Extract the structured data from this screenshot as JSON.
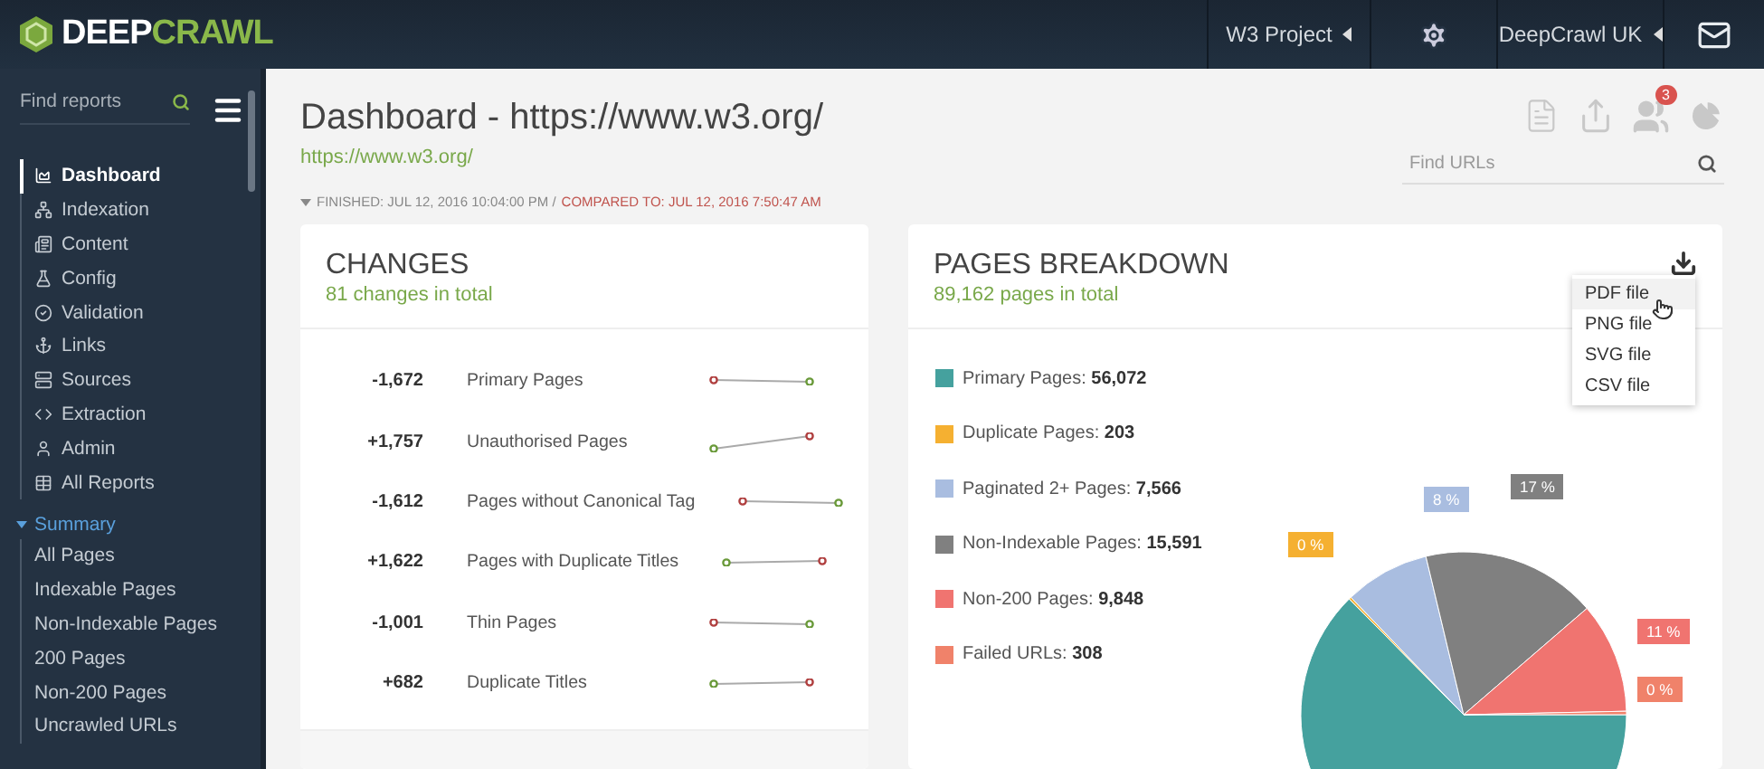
{
  "header": {
    "logo": {
      "lead": "DEEP",
      "tail": "CRAWL"
    },
    "project": "W3 Project",
    "account": "DeepCrawl UK"
  },
  "sidebar": {
    "search": {
      "placeholder": "Find reports"
    },
    "items": [
      {
        "label": "Dashboard",
        "selected": true
      },
      {
        "label": "Indexation",
        "selected": false
      },
      {
        "label": "Content",
        "selected": false
      },
      {
        "label": "Config",
        "selected": false
      },
      {
        "label": "Validation",
        "selected": false
      },
      {
        "label": "Links",
        "selected": false
      },
      {
        "label": "Sources",
        "selected": false
      },
      {
        "label": "Extraction",
        "selected": false
      },
      {
        "label": "Admin",
        "selected": false
      },
      {
        "label": "All Reports",
        "selected": false
      }
    ],
    "section": {
      "label": "Summary",
      "expanded": true,
      "children": [
        "All Pages",
        "Indexable Pages",
        "Non-Indexable Pages",
        "200 Pages",
        "Non-200 Pages",
        "Uncrawled URLs"
      ]
    }
  },
  "page": {
    "title": "Dashboard - https://www.w3.org/",
    "url": "https://www.w3.org/",
    "finished": "FINISHED: JUL 12, 2016 10:04:00 PM /",
    "compared": "COMPARED TO: JUL 12, 2016 7:50:47 AM",
    "notifications": "3",
    "search": {
      "placeholder": "Find URLs"
    }
  },
  "changes": {
    "title": "CHANGES",
    "subtitle": "81 changes in total",
    "rows": [
      {
        "delta": "-1,672",
        "label": "Primary Pages"
      },
      {
        "delta": "+1,757",
        "label": "Unauthorised Pages"
      },
      {
        "delta": "-1,612",
        "label": "Pages without Canonical Tag"
      },
      {
        "delta": "+1,622",
        "label": "Pages with Duplicate Titles"
      },
      {
        "delta": "-1,001",
        "label": "Thin Pages"
      },
      {
        "delta": "+682",
        "label": "Duplicate Titles"
      }
    ]
  },
  "breakdown": {
    "title": "PAGES BREAKDOWN",
    "subtitle": "89,162 pages in total",
    "menu": [
      {
        "label": "PDF file",
        "selected": true
      },
      {
        "label": "PNG file",
        "selected": false
      },
      {
        "label": "SVG file",
        "selected": false
      },
      {
        "label": "CSV file",
        "selected": false
      }
    ],
    "legend": [
      {
        "label": "Primary Pages:",
        "value": "56,072",
        "color": "#45a19e"
      },
      {
        "label": "Duplicate Pages:",
        "value": "203",
        "color": "#f5b031"
      },
      {
        "label": "Paginated 2+ Pages:",
        "value": "7,566",
        "color": "#a9bde0"
      },
      {
        "label": "Non-Indexable Pages:",
        "value": "15,591",
        "color": "#808080"
      },
      {
        "label": "Non-200 Pages:",
        "value": "9,848",
        "color": "#f07470"
      },
      {
        "label": "Failed URLs:",
        "value": "308",
        "color": "#f0826a"
      }
    ],
    "slice_labels": [
      "0 %",
      "8 %",
      "17 %",
      "11 %",
      "0 %"
    ],
    "chart_data": {
      "type": "pie",
      "series": [
        {
          "values": [
            62.59,
            0.23,
            8.45,
            17.4,
            10.99,
            0.34
          ]
        }
      ]
    }
  }
}
